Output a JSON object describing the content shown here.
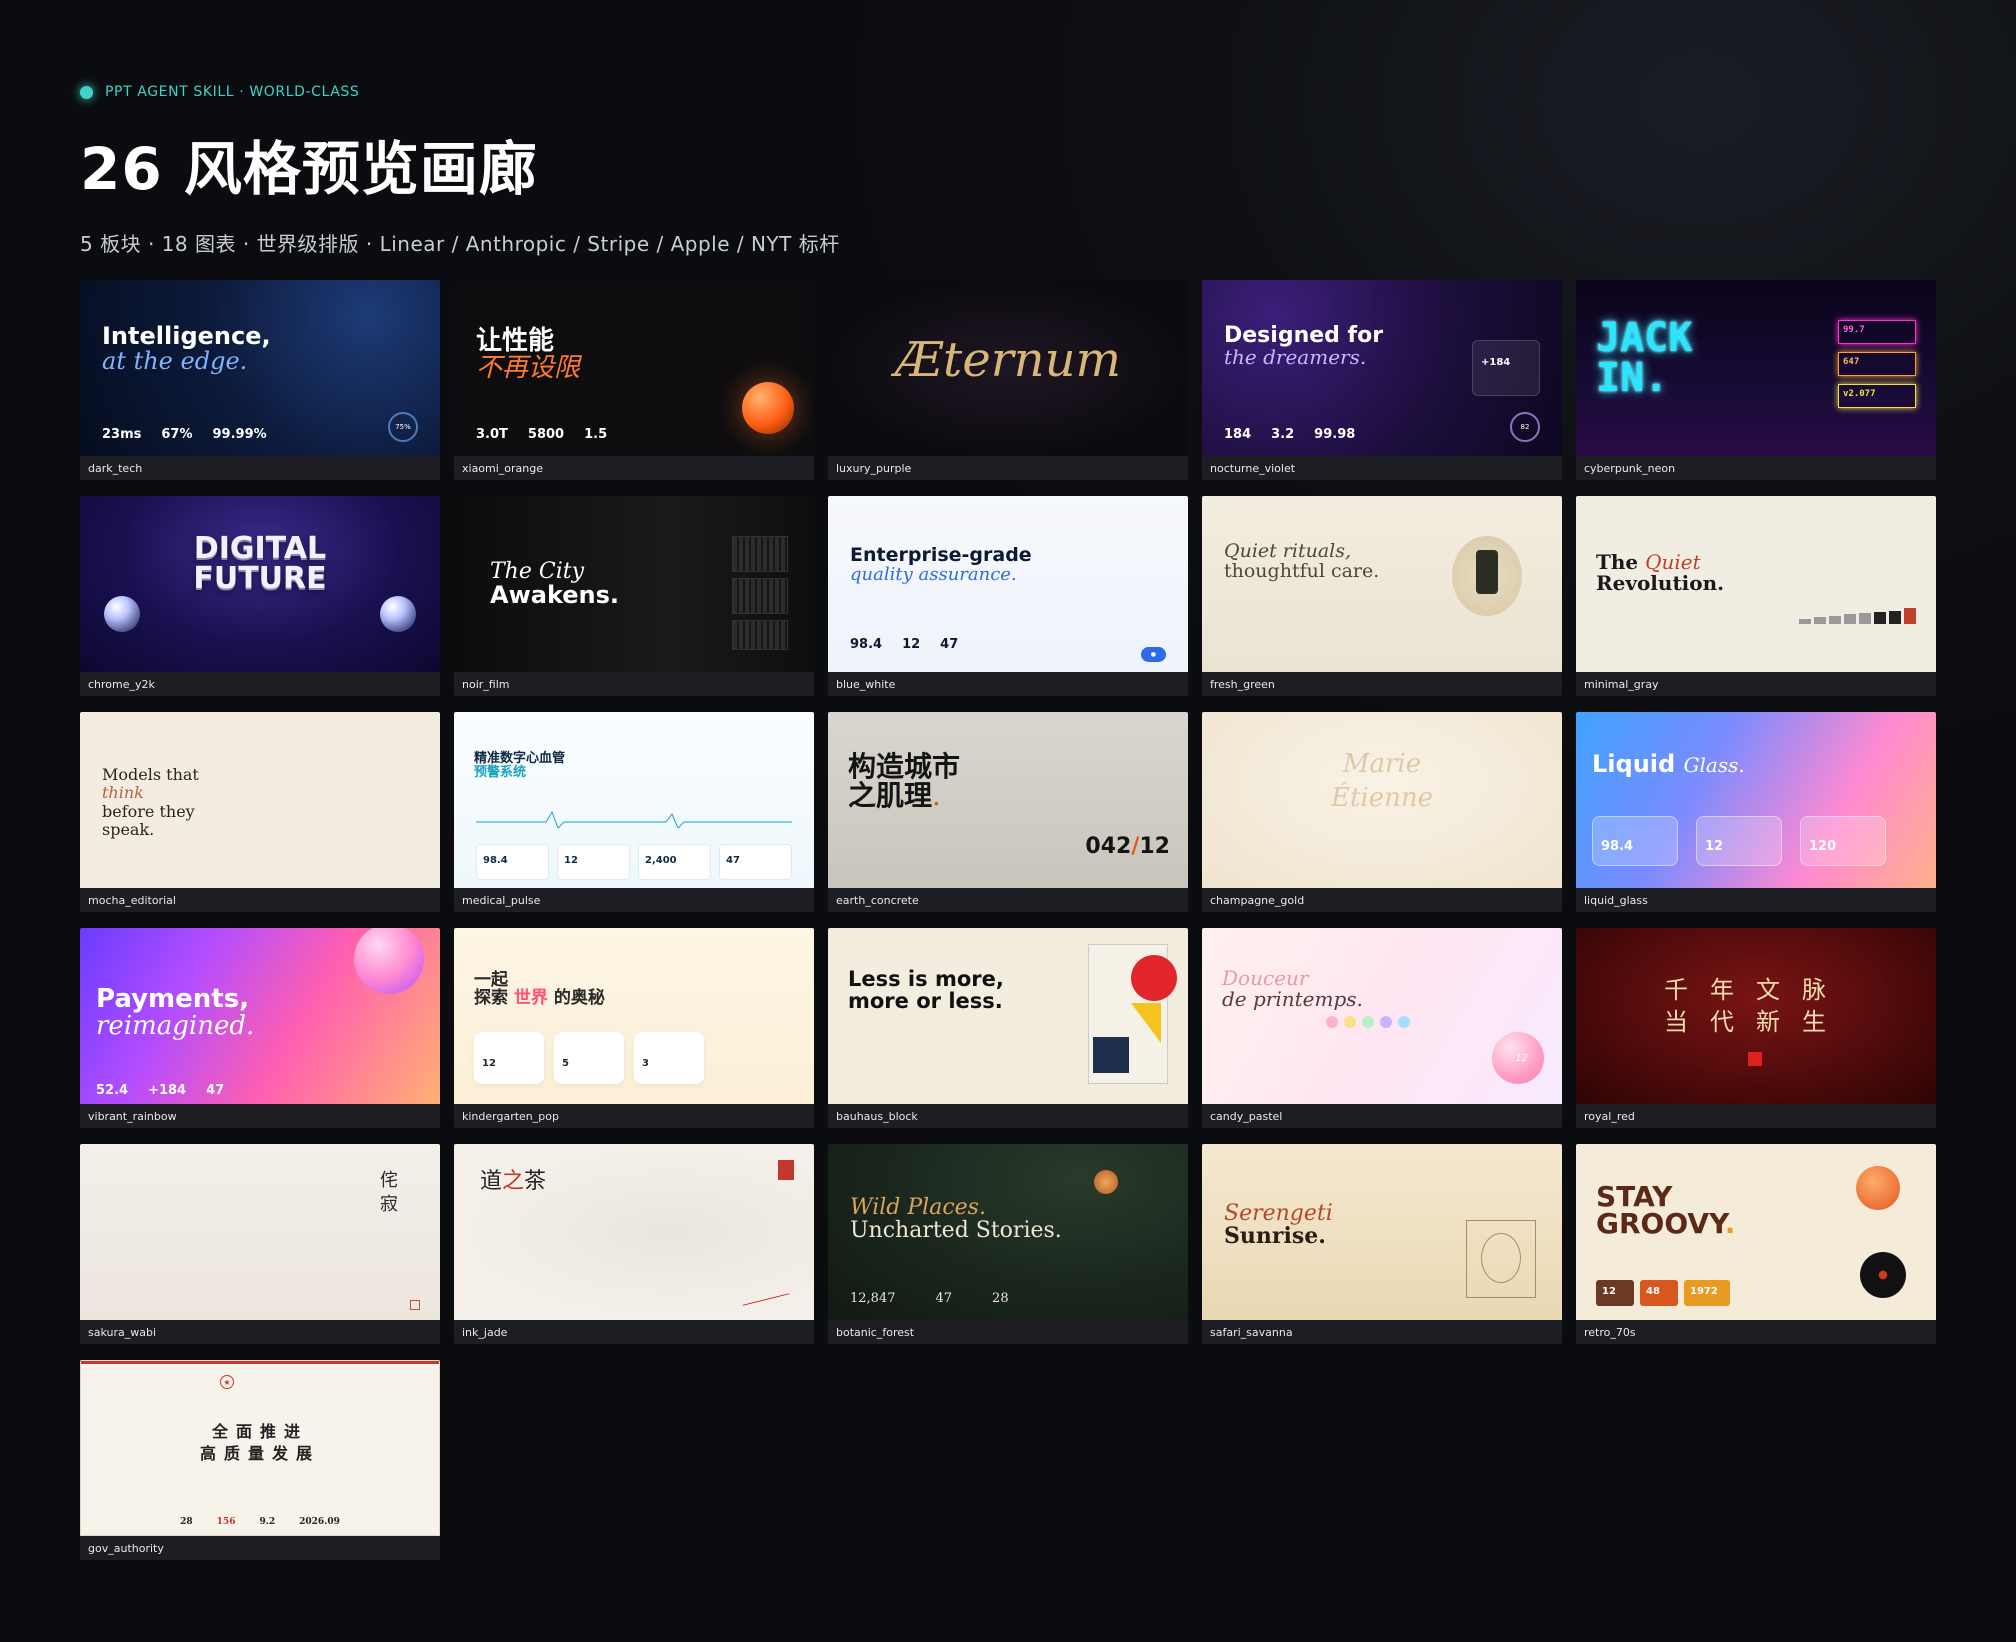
{
  "header": {
    "eyebrow": "PPT AGENT SKILL · WORLD-CLASS",
    "title": "26 风格预览画廊",
    "subtitle": "5 板块 ·  18 图表 ·  世界级排版 ·  Linear / Anthropic / Stripe / Apple / NYT 标杆"
  },
  "colors": {
    "accent": "#3fd3c8",
    "background": "#0e1014",
    "caption_bg": "#1c1e23"
  },
  "cards": [
    {
      "id": "dark_tech",
      "label": "dark_tech",
      "line1": "Intelligence,",
      "line2": "at the edge.",
      "stats": [
        "23ms",
        "67%",
        "99.99%"
      ],
      "ring": "75%"
    },
    {
      "id": "xiaomi_orange",
      "label": "xiaomi_orange",
      "line1": "让性能",
      "line2": "不再设限",
      "stats": [
        "3.0T",
        "5800",
        "1.5"
      ]
    },
    {
      "id": "luxury_purple",
      "label": "luxury_purple",
      "line1": "Æternum"
    },
    {
      "id": "nocturne_violet",
      "label": "nocturne_violet",
      "line1": "Designed for",
      "line2": "the dreamers.",
      "stats": [
        "184",
        "3.2",
        "99.98"
      ],
      "ring": "82",
      "badge": "+184"
    },
    {
      "id": "cyberpunk_neon",
      "label": "cyberpunk_neon",
      "line1": "JACK",
      "line2": "IN.",
      "boxes": [
        "99.7",
        "647",
        "v2.077"
      ]
    },
    {
      "id": "chrome_y2k",
      "label": "chrome_y2k",
      "line1": "DIGITAL",
      "line2": "FUTURE"
    },
    {
      "id": "noir_film",
      "label": "noir_film",
      "line1": "The City",
      "line2": "Awakens."
    },
    {
      "id": "blue_white",
      "label": "blue_white",
      "line1": "Enterprise-grade",
      "line2": "quality assurance.",
      "stats": [
        "98.4",
        "12",
        "47"
      ]
    },
    {
      "id": "fresh_green",
      "label": "fresh_green",
      "line1": "Quiet rituals,",
      "line2": "thoughtful care."
    },
    {
      "id": "minimal_gray",
      "label": "minimal_gray",
      "line1": "The",
      "accent": "Quiet",
      "line2": "Revolution.",
      "bar_values": [
        0.2,
        0.3,
        0.35,
        0.4,
        0.45,
        0.5,
        0.55,
        0.65
      ]
    },
    {
      "id": "mocha_editorial",
      "label": "mocha_editorial",
      "line1": "Models that",
      "accent": "think",
      "line2": "before they",
      "line3": "speak."
    },
    {
      "id": "medical_pulse",
      "label": "medical_pulse",
      "line1": "精准数字心血管",
      "line2": "预警系统",
      "stats": [
        "98.4",
        "12",
        "2,400",
        "47"
      ]
    },
    {
      "id": "earth_concrete",
      "label": "earth_concrete",
      "line1": "构造城市",
      "line2": "之肌理",
      "num_a": "042",
      "num_b": "12"
    },
    {
      "id": "champagne_gold",
      "label": "champagne_gold",
      "line1": "Marie",
      "line2": "Étienne"
    },
    {
      "id": "liquid_glass",
      "label": "liquid_glass",
      "line1": "Liquid",
      "line2": "Glass.",
      "stats": [
        "98.4",
        "12",
        "120"
      ]
    },
    {
      "id": "vibrant_rainbow",
      "label": "vibrant_rainbow",
      "line1": "Payments,",
      "line2": "reimagined.",
      "stats": [
        "52.4",
        "+184",
        "47"
      ]
    },
    {
      "id": "kindergarten_pop",
      "label": "kindergarten_pop",
      "line1": "一起",
      "line2": "探索",
      "accent": "世界",
      "line3": "的奥秘",
      "stats": [
        "12",
        "5",
        "3"
      ]
    },
    {
      "id": "bauhaus_block",
      "label": "bauhaus_block",
      "line1": "Less is more,",
      "line2": "more or less."
    },
    {
      "id": "candy_pastel",
      "label": "candy_pastel",
      "line1": "Douceur",
      "line2": "de printemps.",
      "ball": "12"
    },
    {
      "id": "royal_red",
      "label": "royal_red",
      "line1": "千年文脉",
      "line2": "当代新生"
    },
    {
      "id": "sakura_wabi",
      "label": "sakura_wabi",
      "line1": "侘寂"
    },
    {
      "id": "ink_jade",
      "label": "ink_jade",
      "line1": "道",
      "accent": "之",
      "line2": "茶"
    },
    {
      "id": "botanic_forest",
      "label": "botanic_forest",
      "line1": "Wild Places.",
      "line2": "Uncharted Stories.",
      "stats": [
        "12,847",
        "47",
        "28"
      ]
    },
    {
      "id": "safari_savanna",
      "label": "safari_savanna",
      "line1": "Serengeti",
      "line2": "Sunrise."
    },
    {
      "id": "retro_70s",
      "label": "retro_70s",
      "line1": "STAY",
      "line2": "GROOVY",
      "stats": [
        "12",
        "48",
        "1972"
      ]
    },
    {
      "id": "gov_authority",
      "label": "gov_authority",
      "line1": "全面推进",
      "line2": "高质量发展",
      "stats": [
        "28",
        "156",
        "9.2",
        "2026.09"
      ]
    }
  ]
}
